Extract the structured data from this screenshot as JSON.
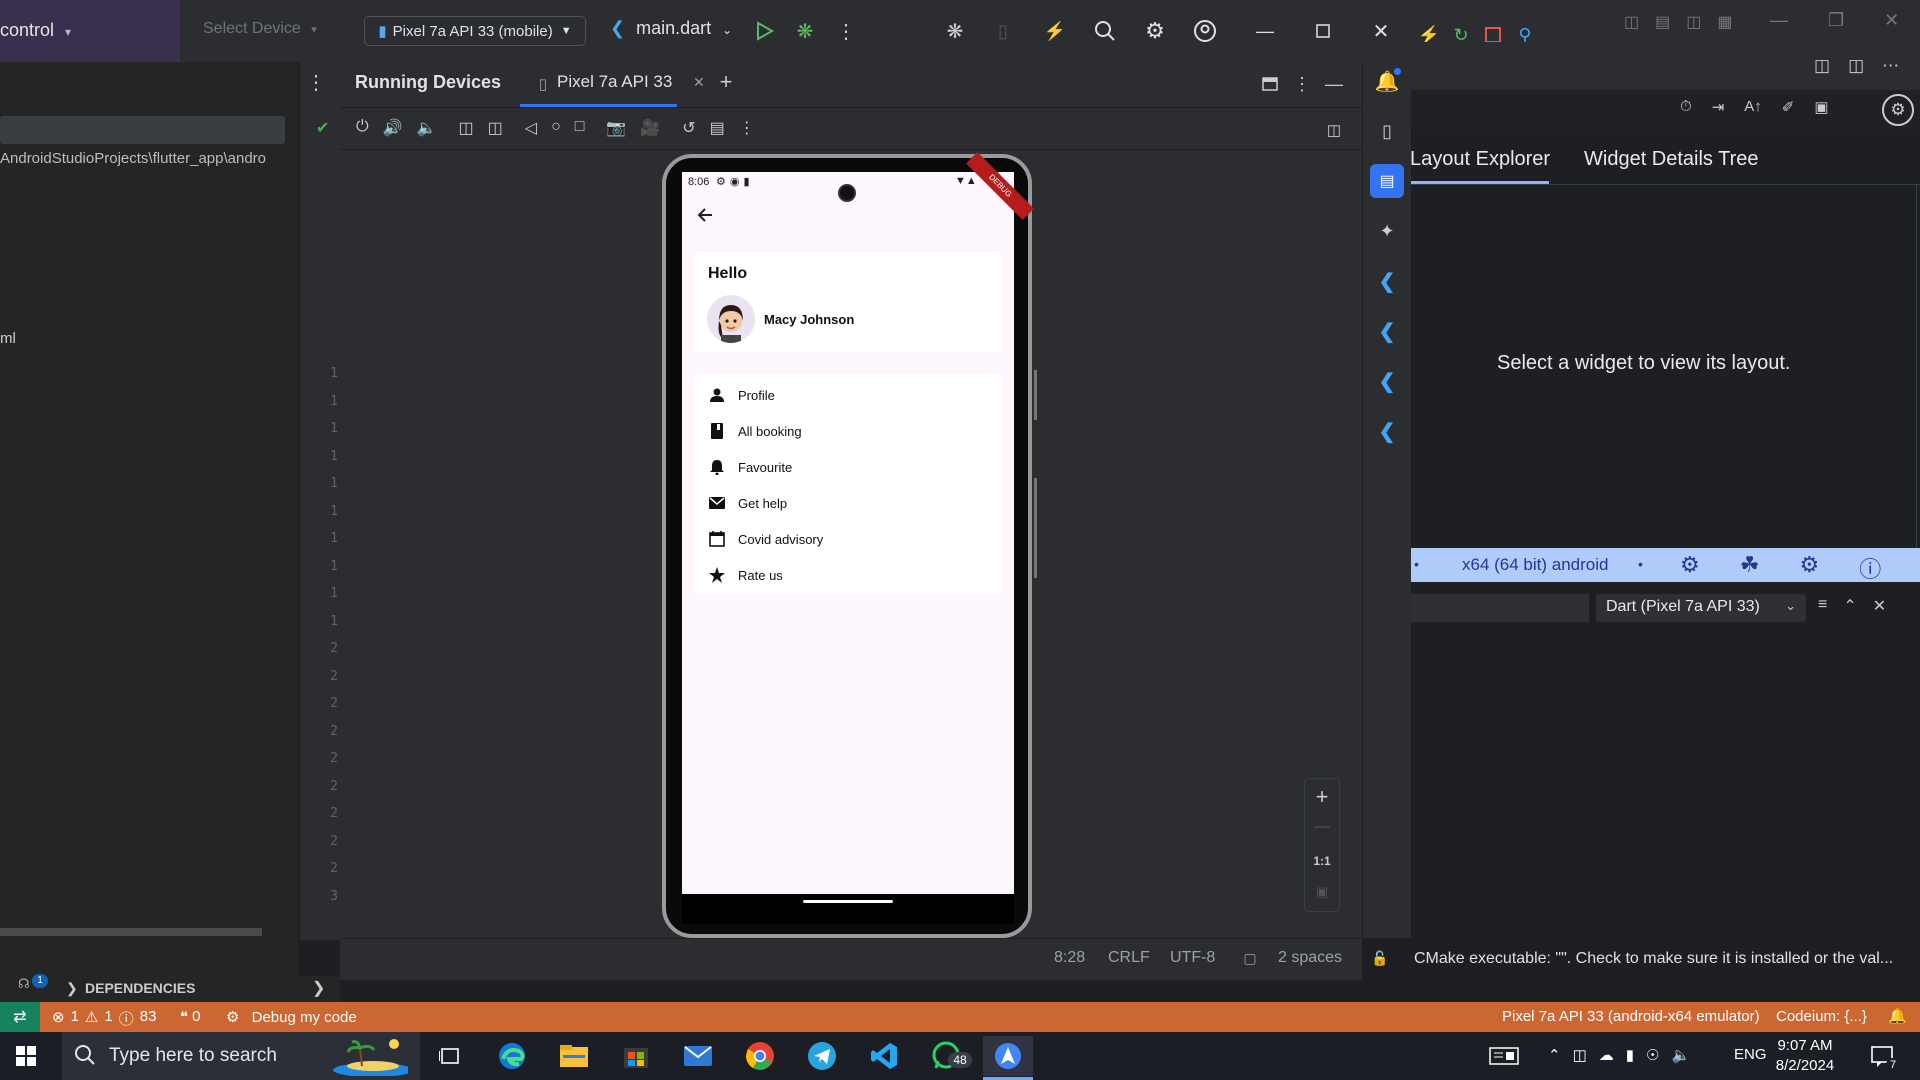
{
  "left_pane": {
    "title": "control",
    "path": "AndroidStudioProjects\\flutter_app\\andro",
    "file_fragment": "ml",
    "gutter_numbers": [
      "1",
      "1",
      "1",
      "1",
      "1",
      "1",
      "1",
      "1",
      "1",
      "1",
      "2",
      "2",
      "2",
      "2",
      "2",
      "2",
      "2",
      "2",
      "2",
      "3"
    ]
  },
  "topbar": {
    "select_device": "Select Device",
    "device_dropdown": "Pixel 7a API 33 (mobile)",
    "run_config": "main.dart"
  },
  "running_devices": {
    "title": "Running Devices",
    "tab_label": "Pixel 7a API 33"
  },
  "phone": {
    "status_time": "8:06",
    "debug_banner": "DEBUG",
    "hello_title": "Hello",
    "user_name": "Macy Johnson",
    "menu": [
      {
        "label": "Profile",
        "icon": "person-icon"
      },
      {
        "label": "All booking",
        "icon": "book-icon"
      },
      {
        "label": "Favourite",
        "icon": "bell-icon"
      },
      {
        "label": "Get help",
        "icon": "mail-icon"
      },
      {
        "label": "Covid advisory",
        "icon": "calendar-icon"
      },
      {
        "label": "Rate us",
        "icon": "star-icon"
      }
    ]
  },
  "zoom": {
    "plus": "+",
    "minus": "—",
    "one_to_one": "1:1"
  },
  "as_status": {
    "cursor": "8:28",
    "line_sep": "CRLF",
    "encoding": "UTF-8",
    "indent": "2 spaces"
  },
  "devtools": {
    "tab_layout": "Layout Explorer",
    "tab_tree": "Widget Details Tree",
    "hint": "Select a widget to view its layout.",
    "arch": "x64 (64 bit) android",
    "dart_dropdown": "Dart (Pixel 7a API 33)",
    "cmake_msg": "CMake executable: \"\". Check to make sure it is installed or the val..."
  },
  "vs_bottom": {
    "deps_label": "DEPENDENCIES",
    "errors": "1",
    "warnings": "1",
    "infos": "83",
    "ports": "0",
    "debug_label": "Debug my code",
    "emulator": "Pixel 7a API 33 (android-x64 emulator)",
    "codeium": "Codeium: {...}",
    "badge": "1"
  },
  "taskbar": {
    "search_placeholder": "Type here to search",
    "whatsapp_badge": "48",
    "lang": "ENG",
    "time": "9:07 AM",
    "date": "8/2/2024",
    "notif_count": "7"
  },
  "colors": {
    "status_orange": "#cc6633",
    "accent_blue": "#3574f0",
    "bluebar": "#aecbfa",
    "screen_bg": "#fdf6fd"
  }
}
